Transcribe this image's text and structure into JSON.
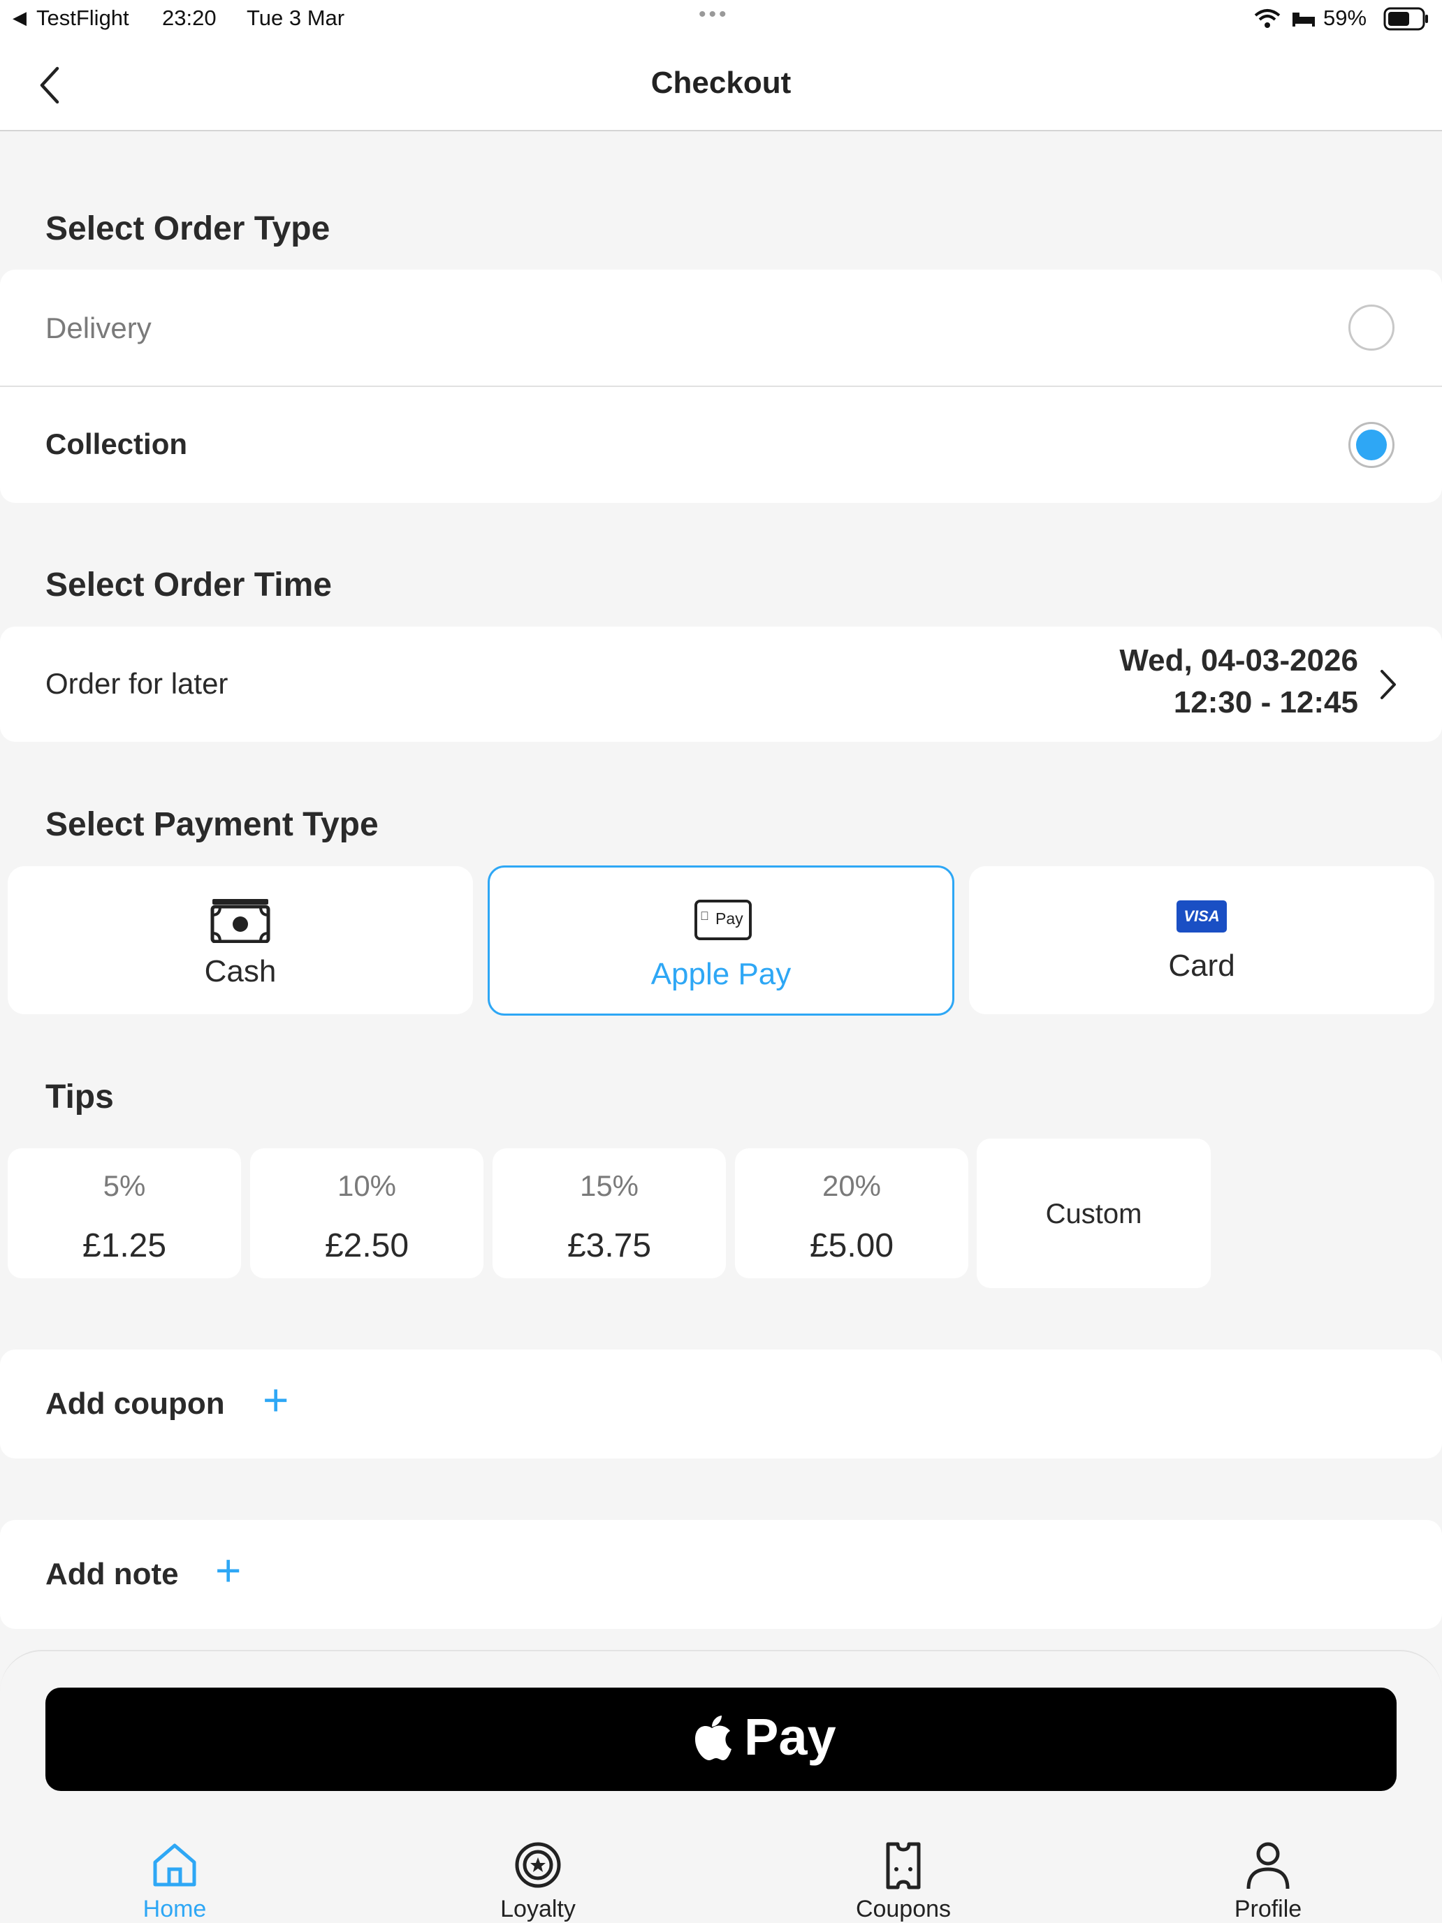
{
  "status_bar": {
    "back_app": "TestFlight",
    "time": "23:20",
    "date": "Tue 3 Mar",
    "battery": "59%"
  },
  "header": {
    "title": "Checkout"
  },
  "order_type": {
    "title": "Select Order Type",
    "options": [
      {
        "label": "Delivery",
        "selected": false
      },
      {
        "label": "Collection",
        "selected": true
      }
    ]
  },
  "order_time": {
    "title": "Select Order Time",
    "label": "Order for later",
    "date": "Wed, 04-03-2026",
    "slot": "12:30 - 12:45"
  },
  "payment_type": {
    "title": "Select Payment Type",
    "options": [
      {
        "label": "Cash",
        "icon": "cash-icon",
        "selected": false
      },
      {
        "label": "Apple Pay",
        "icon": "apple-pay-icon",
        "selected": true
      },
      {
        "label": "Card",
        "icon": "visa-icon",
        "selected": false
      }
    ],
    "apple_pay_badge": "Pay",
    "visa_badge": "VISA"
  },
  "tips": {
    "title": "Tips",
    "options": [
      {
        "pct": "5%",
        "amount": "£1.25"
      },
      {
        "pct": "10%",
        "amount": "£2.50"
      },
      {
        "pct": "15%",
        "amount": "£3.75"
      },
      {
        "pct": "20%",
        "amount": "£5.00"
      }
    ],
    "custom_label": "Custom"
  },
  "coupon": {
    "label": "Add coupon"
  },
  "note": {
    "label": "Add note"
  },
  "pay_button": {
    "label": "Pay"
  },
  "tabs": [
    {
      "label": "Home",
      "active": true
    },
    {
      "label": "Loyalty",
      "active": false
    },
    {
      "label": "Coupons",
      "active": false
    },
    {
      "label": "Profile",
      "active": false
    }
  ],
  "colors": {
    "accent": "#2ea7f5",
    "text": "#222222",
    "muted": "#7a7a7a",
    "visa": "#1a4fc4"
  }
}
